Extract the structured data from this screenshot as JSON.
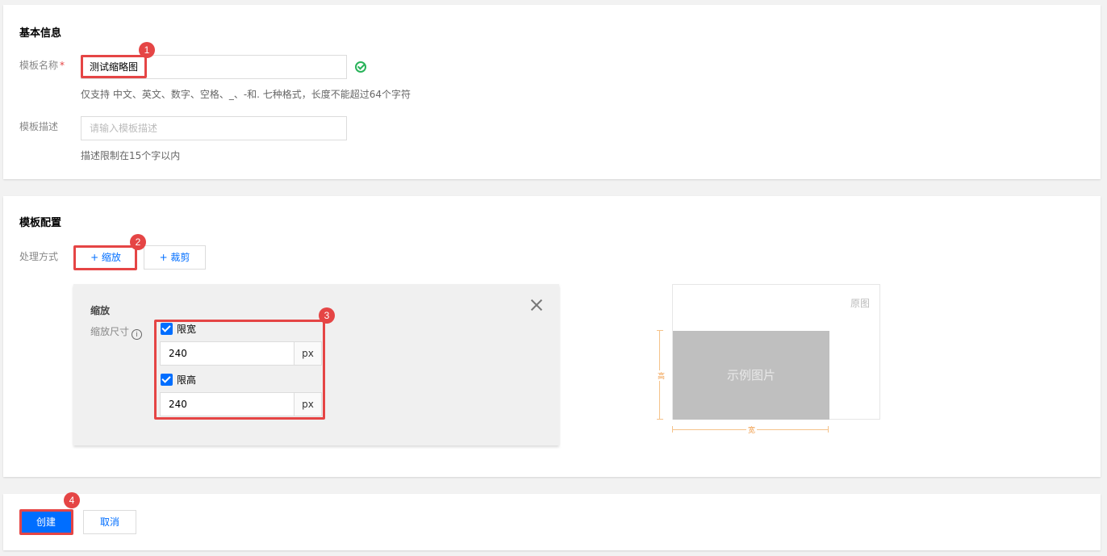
{
  "basic": {
    "title": "基本信息",
    "name_label": "模板名称",
    "required_mark": "*",
    "name_value": "测试缩略图",
    "name_hint": "仅支持 中文、英文、数字、空格、_、-和. 七种格式，长度不能超过64个字符",
    "desc_label": "模板描述",
    "desc_placeholder": "请输入模板描述",
    "desc_hint": "描述限制在15个字以内"
  },
  "config": {
    "title": "模板配置",
    "method_label": "处理方式",
    "scale_button": "+ 缩放",
    "crop_button": "+ 裁剪",
    "panel": {
      "title": "缩放",
      "size_label": "缩放尺寸",
      "info_glyph": "i",
      "limit_width_label": "限宽",
      "limit_width_checked": true,
      "width_value": "240",
      "width_unit": "px",
      "limit_height_label": "限高",
      "limit_height_checked": true,
      "height_value": "240",
      "height_unit": "px"
    },
    "preview": {
      "original_label": "原图",
      "example_label": "示例图片",
      "height_label": "高",
      "width_label": "宽"
    }
  },
  "actions": {
    "create_button": "创建",
    "cancel_button": "取消"
  },
  "markers": [
    "1",
    "2",
    "3",
    "4"
  ],
  "colors": {
    "primary": "#006eff",
    "highlight": "#e54545",
    "success": "#29b35a",
    "dimension": "#f5c28a"
  }
}
